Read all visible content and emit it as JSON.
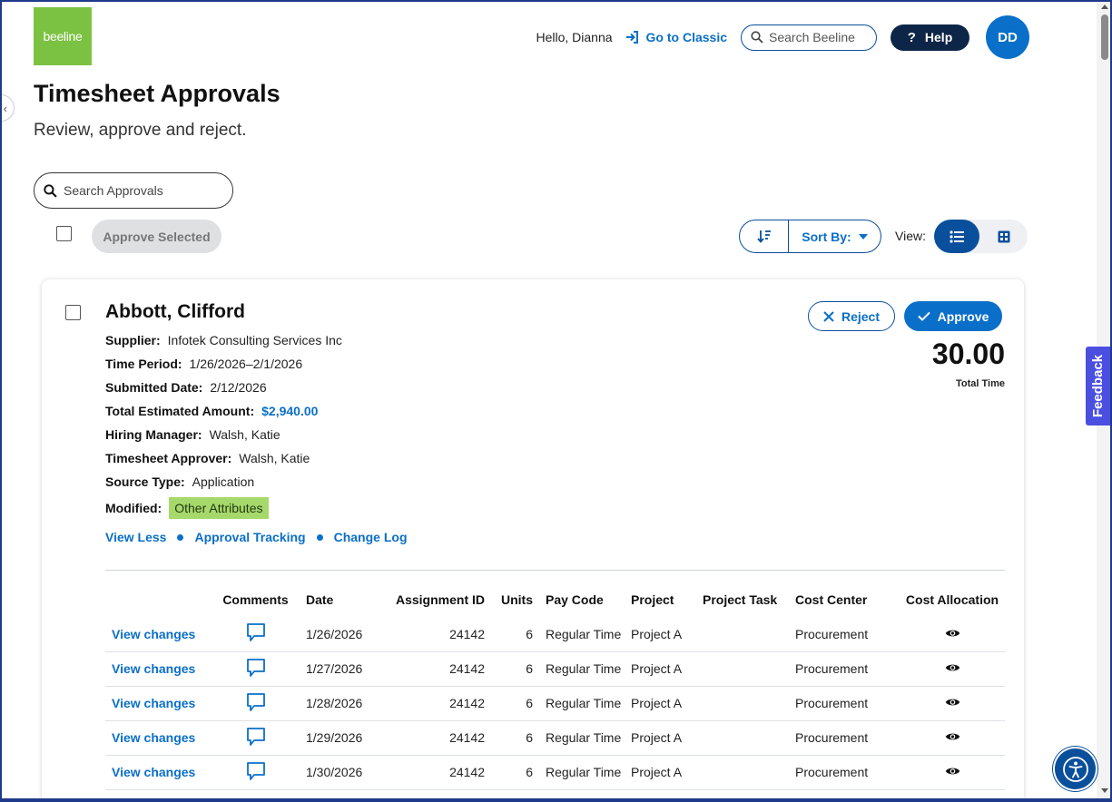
{
  "brand": {
    "logo_text": "beeline",
    "color": "#7cc242"
  },
  "header": {
    "greeting": "Hello, Dianna",
    "classic_link": "Go to Classic",
    "search_placeholder": "Search Beeline",
    "help_label": "Help",
    "avatar_initials": "DD"
  },
  "page": {
    "title": "Timesheet Approvals",
    "subtitle": "Review, approve and reject."
  },
  "toolbar": {
    "search_placeholder": "Search Approvals",
    "approve_selected": "Approve Selected",
    "sort_by": "Sort By:",
    "view_label": "View:"
  },
  "card": {
    "worker_name": "Abbott, Clifford",
    "details": [
      {
        "label": "Supplier:",
        "value": "Infotek Consulting Services Inc"
      },
      {
        "label": "Time Period:",
        "value": "1/26/2026–2/1/2026"
      },
      {
        "label": "Submitted Date:",
        "value": "2/12/2026"
      },
      {
        "label": "Total Estimated Amount:",
        "value": "$2,940.00"
      },
      {
        "label": "Hiring Manager:",
        "value": "Walsh, Katie"
      },
      {
        "label": "Timesheet Approver:",
        "value": "Walsh, Katie"
      },
      {
        "label": "Source Type:",
        "value": "Application"
      },
      {
        "label": "Modified:",
        "value": "Other Attributes"
      }
    ],
    "links": [
      "View Less",
      "Approval Tracking",
      "Change Log"
    ],
    "reject_label": "Reject",
    "approve_label": "Approve",
    "total_value": "30.00",
    "total_label": "Total Time",
    "table": {
      "headers": [
        "",
        "Comments",
        "Date",
        "Assignment ID",
        "Units",
        "Pay Code",
        "Project",
        "Project Task",
        "Cost Center",
        "Cost Allocation"
      ],
      "rows": [
        {
          "view": "View changes",
          "date": "1/26/2026",
          "assignment": "24142",
          "units": "6",
          "pay_code": "Regular Time",
          "project": "Project A",
          "task": "",
          "cost_center": "Procurement"
        },
        {
          "view": "View changes",
          "date": "1/27/2026",
          "assignment": "24142",
          "units": "6",
          "pay_code": "Regular Time",
          "project": "Project A",
          "task": "",
          "cost_center": "Procurement"
        },
        {
          "view": "View changes",
          "date": "1/28/2026",
          "assignment": "24142",
          "units": "6",
          "pay_code": "Regular Time",
          "project": "Project A",
          "task": "",
          "cost_center": "Procurement"
        },
        {
          "view": "View changes",
          "date": "1/29/2026",
          "assignment": "24142",
          "units": "6",
          "pay_code": "Regular Time",
          "project": "Project A",
          "task": "",
          "cost_center": "Procurement"
        },
        {
          "view": "View changes",
          "date": "1/30/2026",
          "assignment": "24142",
          "units": "6",
          "pay_code": "Regular Time",
          "project": "Project A",
          "task": "",
          "cost_center": "Procurement"
        }
      ]
    }
  },
  "feedback_tab": "Feedback",
  "colors": {
    "primary": "#0a6fc9",
    "navy": "#0d2547",
    "badge": "#a7d86b",
    "feedback": "#4a4fe0"
  },
  "icons": [
    "sign-in-icon",
    "search-icon",
    "question-icon",
    "sort-direction-icon",
    "caret-down-icon",
    "list-view-icon",
    "grid-view-icon",
    "close-icon",
    "check-icon",
    "comment-icon",
    "eye-icon",
    "accessibility-icon"
  ]
}
